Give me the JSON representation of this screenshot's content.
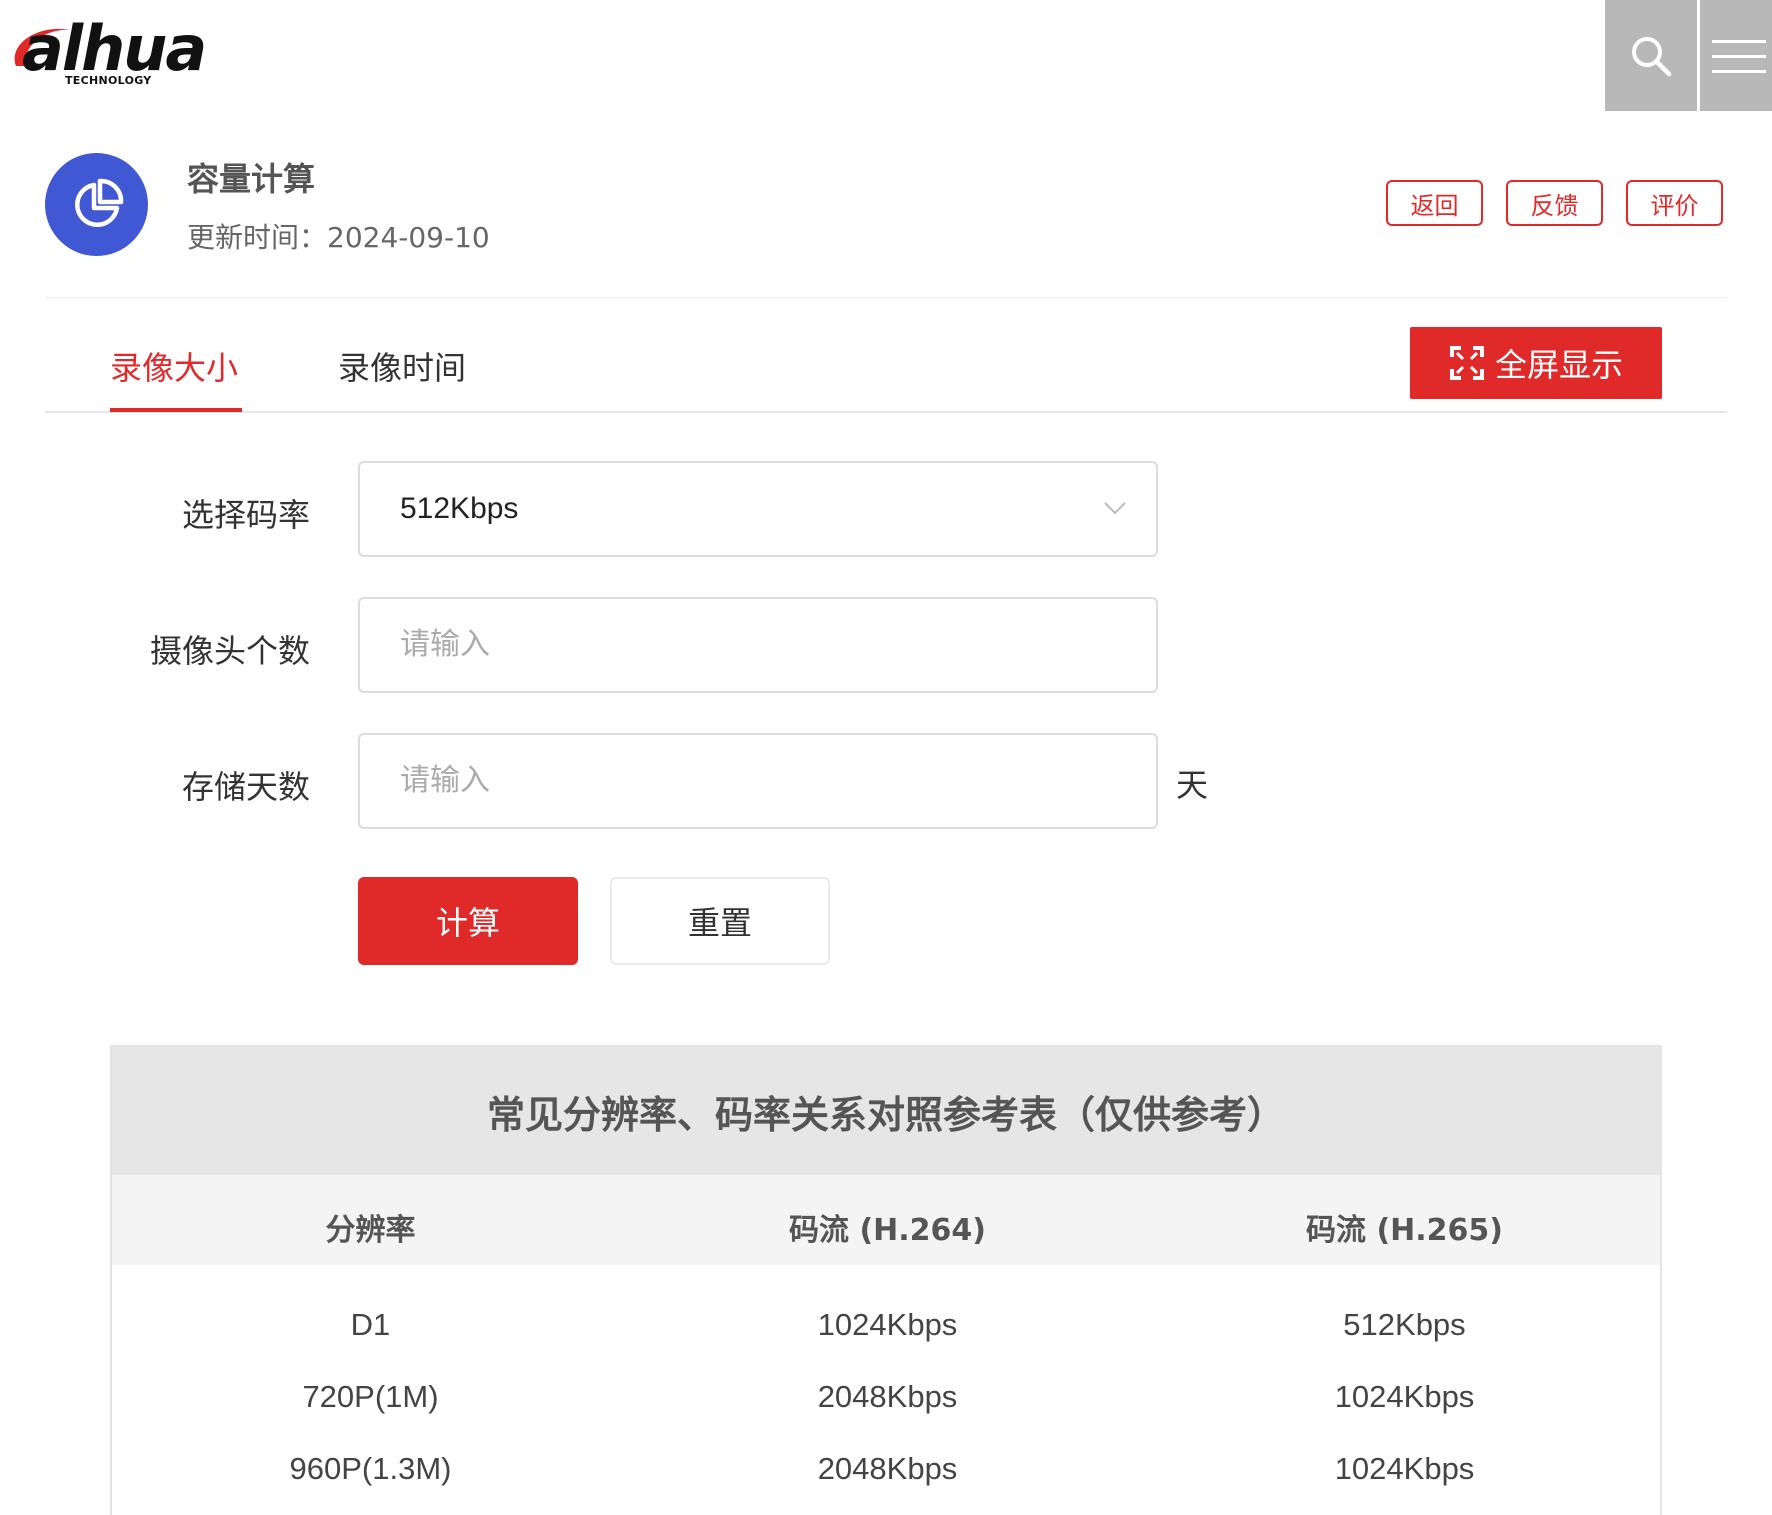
{
  "brand": {
    "logo_text": "alhua",
    "logo_tag": "TECHNOLOGY"
  },
  "app": {
    "title": "容量计算",
    "updated": "更新时间：2024-09-10"
  },
  "header_buttons": {
    "back": "返回",
    "feedback": "反馈",
    "rate": "评价"
  },
  "tabs": [
    {
      "label": "录像大小",
      "active": true
    },
    {
      "label": "录像时间",
      "active": false
    }
  ],
  "fullscreen_label": "全屏显示",
  "form": {
    "bitrate_label": "选择码率",
    "bitrate_value": "512Kbps",
    "cameras_label": "摄像头个数",
    "cameras_placeholder": "请输入",
    "days_label": "存储天数",
    "days_placeholder": "请输入",
    "days_unit": "天",
    "calc_label": "计算",
    "reset_label": "重置"
  },
  "reference": {
    "title": "常见分辨率、码率关系对照参考表（仅供参考）",
    "headers": [
      "分辨率",
      "码流 (H.264)",
      "码流 (H.265)"
    ],
    "rows": [
      [
        "D1",
        "1024Kbps",
        "512Kbps"
      ],
      [
        "720P(1M)",
        "2048Kbps",
        "1024Kbps"
      ],
      [
        "960P(1.3M)",
        "2048Kbps",
        "1024Kbps"
      ]
    ]
  },
  "colors": {
    "accent": "#e02a2a",
    "icon_bg": "#4158d4",
    "topbar_button": "#b8b8b8"
  }
}
